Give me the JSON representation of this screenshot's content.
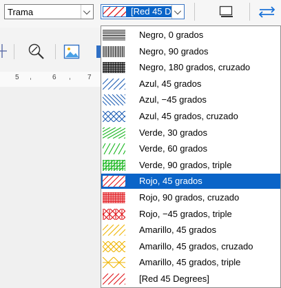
{
  "toolbar": {
    "area_style_value": "Trama",
    "hatch_selected_label": "[Red 45 Degrees]"
  },
  "colors": {
    "selection": "#0a64c8",
    "black": "#000000",
    "blue": "#1f5fb5",
    "green": "#17b51d",
    "red": "#e0141a",
    "yellow": "#f0b400"
  },
  "ruler": {
    "marks": [
      "5",
      "6",
      "7"
    ]
  },
  "hatch_list": [
    {
      "label": "Negro, 0 grados",
      "color": "black",
      "pattern": "h"
    },
    {
      "label": "Negro, 90 grados",
      "color": "black",
      "pattern": "v"
    },
    {
      "label": "Negro, 180 grados, cruzado",
      "color": "black",
      "pattern": "hv"
    },
    {
      "label": "Azul, 45 grados",
      "color": "blue",
      "pattern": "d45"
    },
    {
      "label": "Azul, −45 grados",
      "color": "blue",
      "pattern": "dm45"
    },
    {
      "label": "Azul, 45 grados, cruzado",
      "color": "blue",
      "pattern": "x"
    },
    {
      "label": "Verde, 30 grados",
      "color": "green",
      "pattern": "d30"
    },
    {
      "label": "Verde, 60 grados",
      "color": "green",
      "pattern": "d60"
    },
    {
      "label": "Verde, 90 grados, triple",
      "color": "green",
      "pattern": "hvd"
    },
    {
      "label": "Rojo, 45 grados",
      "color": "red",
      "pattern": "d45",
      "selected": true
    },
    {
      "label": "Rojo, 90 grados, cruzado",
      "color": "red",
      "pattern": "hv"
    },
    {
      "label": "Rojo, −45 grados, triple",
      "color": "red",
      "pattern": "xv"
    },
    {
      "label": "Amarillo, 45 grados",
      "color": "yellow",
      "pattern": "d45"
    },
    {
      "label": "Amarillo, 45 grados, cruzado",
      "color": "yellow",
      "pattern": "x"
    },
    {
      "label": "Amarillo, 45 grados, triple",
      "color": "yellow",
      "pattern": "xh"
    },
    {
      "label": "[Red 45 Degrees]",
      "color": "red",
      "pattern": "d45"
    }
  ]
}
